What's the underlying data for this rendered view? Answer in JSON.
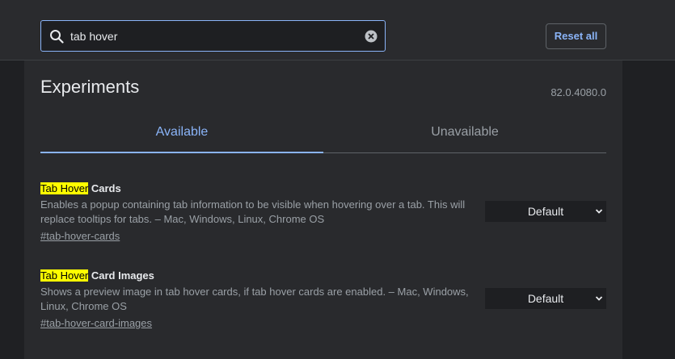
{
  "search": {
    "value": "tab hover"
  },
  "toolbar": {
    "reset_label": "Reset all"
  },
  "page": {
    "title": "Experiments",
    "version": "82.0.4080.0"
  },
  "tabs": [
    {
      "label": "Available",
      "active": true
    },
    {
      "label": "Unavailable",
      "active": false
    }
  ],
  "experiments": [
    {
      "highlight": "Tab Hover",
      "title_rest": " Cards",
      "description": "Enables a popup containing tab information to be visible when hovering over a tab. This will replace tooltips for tabs. – Mac, Windows, Linux, Chrome OS",
      "link": "#tab-hover-cards",
      "select_value": "Default"
    },
    {
      "highlight": "Tab Hover",
      "title_rest": " Card Images",
      "description": "Shows a preview image in tab hover cards, if tab hover cards are enabled. – Mac, Windows, Linux, Chrome OS",
      "link": "#tab-hover-card-images",
      "select_value": "Default"
    }
  ],
  "icons": {
    "search": "search-icon",
    "clear": "clear-icon",
    "dropdown": "chevron-down-icon"
  },
  "colors": {
    "accent": "#8ab4f8",
    "highlight": "#ffff00",
    "panel": "#292a2d"
  }
}
